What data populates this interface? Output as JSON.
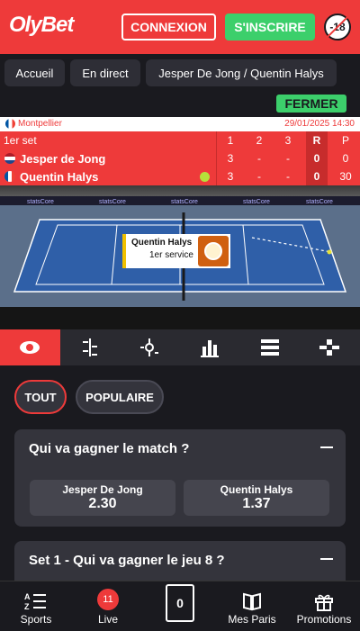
{
  "header": {
    "logo": "OlyBet",
    "connexion": "CONNEXION",
    "inscrire": "S'INSCRIRE",
    "age": "-18"
  },
  "breadcrumb": [
    "Accueil",
    "En direct",
    "Jesper De Jong / Quentin Halys"
  ],
  "close_label": "FERMER",
  "match": {
    "location": "Montpellier",
    "datetime": "29/01/2025 14:30",
    "set_label": "1er set",
    "cols": [
      "1",
      "2",
      "3",
      "R",
      "P"
    ],
    "players": [
      {
        "name": "Jesper de Jong",
        "scores": [
          "3",
          "-",
          "-",
          "0",
          "0"
        ]
      },
      {
        "name": "Quentin Halys",
        "scores": [
          "3",
          "-",
          "-",
          "0",
          "30"
        ]
      }
    ]
  },
  "court": {
    "server_name": "Quentin Halys",
    "server_status": "1er service",
    "sponsor": "statsCore"
  },
  "filters": [
    "TOUT",
    "POPULAIRE"
  ],
  "markets": [
    {
      "title": "Qui va gagner le match ?",
      "odds": [
        {
          "name": "Jesper De Jong",
          "value": "2.30"
        },
        {
          "name": "Quentin Halys",
          "value": "1.37"
        }
      ]
    },
    {
      "title": "Set 1 - Qui va gagner le jeu 8 ?"
    }
  ],
  "nav": {
    "sports": "Sports",
    "live": "Live",
    "live_count": "11",
    "slip_count": "0",
    "mes_paris": "Mes Paris",
    "promotions": "Promotions"
  },
  "colors": {
    "brand": "#ee3a3a",
    "green": "#3ccf6b",
    "bg": "#1a1a1f",
    "card": "#34343c"
  }
}
